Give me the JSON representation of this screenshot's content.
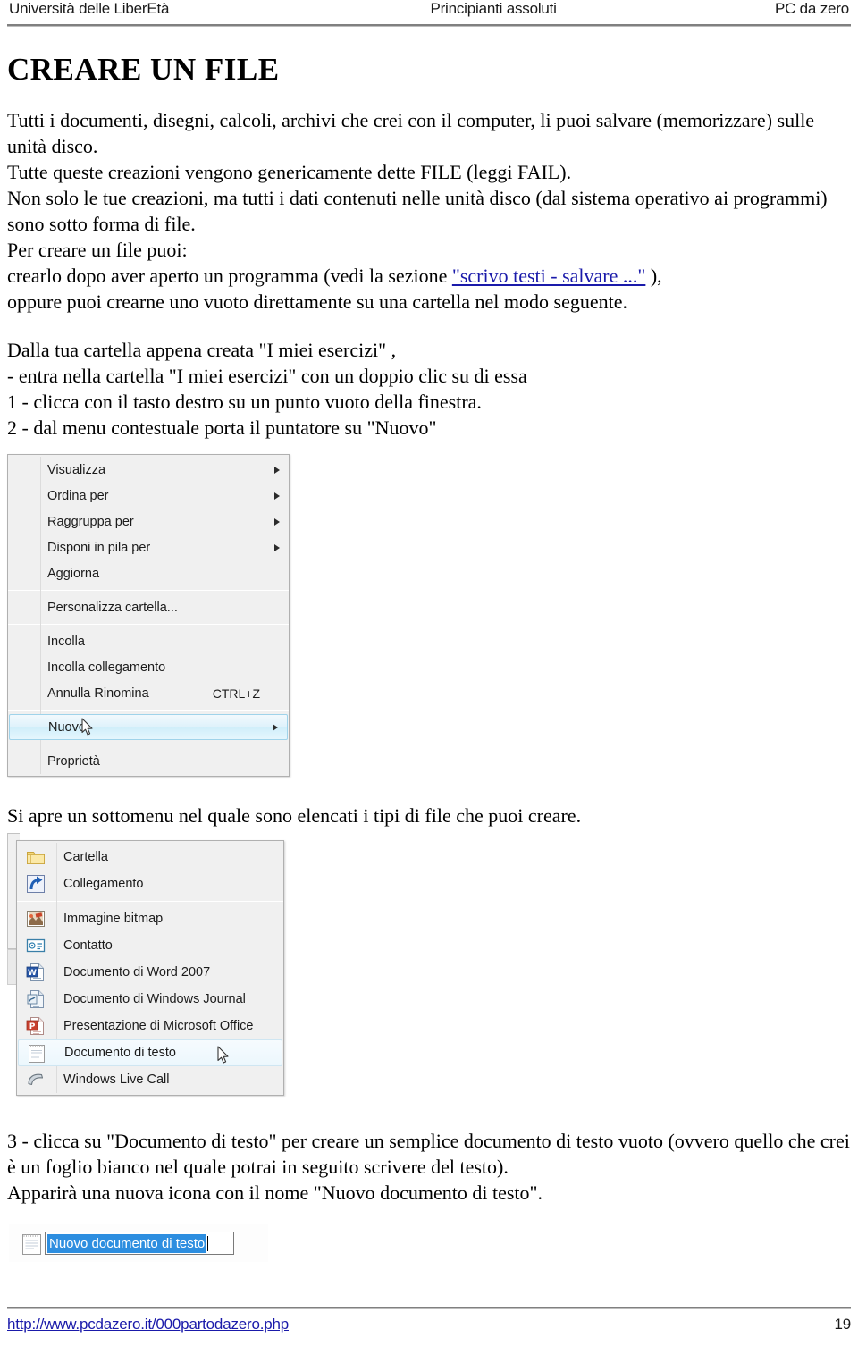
{
  "header": {
    "left": "Università delle LiberEtà",
    "center": "Principianti assoluti",
    "right": "PC da zero"
  },
  "doc": {
    "title": "CREARE UN FILE",
    "paragraph1_a": "Tutti i documenti, disegni, calcoli, archivi che crei con il computer, li puoi salvare (memorizzare) sulle unità disco.",
    "paragraph1_b": "Tutte queste creazioni vengono genericamente dette FILE (leggi FAIL).",
    "paragraph1_c": "Non solo le tue creazioni, ma tutti i dati contenuti nelle unità disco (dal sistema operativo ai programmi) sono sotto forma di file.",
    "paragraph1_d": "Per creare un file puoi:",
    "paragraph1_e_pre": "crearlo dopo aver aperto un programma (vedi la sezione ",
    "paragraph1_e_link": "\"scrivo testi - salvare ...\"",
    "paragraph1_e_post": " ),",
    "paragraph1_f": "oppure puoi crearne uno vuoto direttamente su una cartella nel modo seguente.",
    "paragraph2_a": "Dalla tua cartella appena creata \"I miei esercizi\" ,",
    "paragraph2_b": "- entra nella cartella \"I miei esercizi\" con un doppio clic su di essa",
    "paragraph2_c": "1 - clicca con il tasto destro su un punto vuoto della finestra.",
    "paragraph2_d": "2 - dal menu contestuale porta il puntatore su \"Nuovo\"",
    "caption_submenu": "Si apre un sottomenu nel quale sono elencati i tipi di file che puoi creare.",
    "paragraph3_a": "3 - clicca su \"Documento di testo\" per creare un semplice documento di testo vuoto (ovvero quello che crei è un foglio bianco nel quale potrai in seguito scrivere del testo).",
    "paragraph3_b": "Apparirà una nuova icona con il nome \"Nuovo documento di testo\"."
  },
  "context_menu": {
    "items": [
      {
        "label": "Visualizza",
        "accel": "",
        "submenu": true,
        "selected": false,
        "separator_after": false
      },
      {
        "label": "Ordina per",
        "accel": "",
        "submenu": true,
        "selected": false,
        "separator_after": false
      },
      {
        "label": "Raggruppa per",
        "accel": "",
        "submenu": true,
        "selected": false,
        "separator_after": false
      },
      {
        "label": "Disponi in pila per",
        "accel": "",
        "submenu": true,
        "selected": false,
        "separator_after": false
      },
      {
        "label": "Aggiorna",
        "accel": "",
        "submenu": false,
        "selected": false,
        "separator_after": true
      },
      {
        "label": "Personalizza cartella...",
        "accel": "",
        "submenu": false,
        "selected": false,
        "separator_after": true
      },
      {
        "label": "Incolla",
        "accel": "",
        "submenu": false,
        "selected": false,
        "separator_after": false
      },
      {
        "label": "Incolla collegamento",
        "accel": "",
        "submenu": false,
        "selected": false,
        "separator_after": false
      },
      {
        "label": "Annulla Rinomina",
        "accel": "CTRL+Z",
        "submenu": false,
        "selected": false,
        "separator_after": true
      },
      {
        "label": "Nuovo",
        "accel": "",
        "submenu": true,
        "selected": true,
        "separator_after": true
      },
      {
        "label": "Proprietà",
        "accel": "",
        "submenu": false,
        "selected": false,
        "separator_after": false
      }
    ]
  },
  "submenu": {
    "items": [
      {
        "label": "Cartella",
        "icon": "folder-icon",
        "selected": false,
        "separator_after": false
      },
      {
        "label": "Collegamento",
        "icon": "shortcut-icon",
        "selected": false,
        "separator_after": true
      },
      {
        "label": "Immagine bitmap",
        "icon": "bitmap-image-icon",
        "selected": false,
        "separator_after": false
      },
      {
        "label": "Contatto",
        "icon": "contact-card-icon",
        "selected": false,
        "separator_after": false
      },
      {
        "label": "Documento di Word 2007",
        "icon": "word-document-icon",
        "selected": false,
        "separator_after": false
      },
      {
        "label": "Documento di Windows Journal",
        "icon": "journal-document-icon",
        "selected": false,
        "separator_after": false
      },
      {
        "label": "Presentazione di Microsoft Office",
        "icon": "powerpoint-icon",
        "selected": false,
        "separator_after": false
      },
      {
        "label": "Documento di testo",
        "icon": "text-document-icon",
        "selected": true,
        "separator_after": false
      },
      {
        "label": "Windows Live Call",
        "icon": "phone-call-icon",
        "selected": false,
        "separator_after": false
      }
    ]
  },
  "rename_box": {
    "value": "Nuovo documento di testo",
    "icon": "text-document-icon"
  },
  "footer": {
    "url": "http://www.pcdazero.it/000partodazero.php",
    "page_number": "19"
  },
  "colors": {
    "link": "#1a1aaa",
    "selection_blue": "#2d8ee0",
    "menu_bg": "#f0f0f0",
    "rule_gray": "#808080"
  }
}
